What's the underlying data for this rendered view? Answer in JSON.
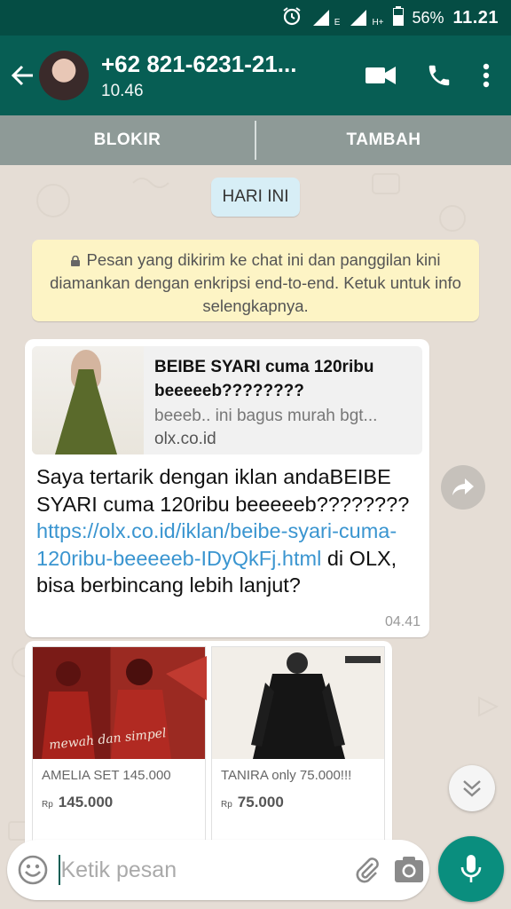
{
  "status_bar": {
    "network_left": "E",
    "network_right": "H+",
    "battery": "56%",
    "time": "11.21"
  },
  "header": {
    "contact_name": "+62 821-6231-21...",
    "last_seen": "10.46"
  },
  "actions": {
    "block_label": "BLOKIR",
    "add_label": "TAMBAH"
  },
  "chat": {
    "date_chip": "HARI INI",
    "encryption_notice": "Pesan yang dikirim ke chat ini dan panggilan kini diamankan dengan enkripsi end-to-end. Ketuk untuk info selengkapnya.",
    "message": {
      "preview_title": "BEIBE SYARI cuma 120ribu beeeeeb????????",
      "preview_desc": "beeeb.. ini bagus murah bgt...",
      "preview_domain": "olx.co.id",
      "text_before": "Saya tertarik dengan iklan andaBEIBE SYARI cuma 120ribu beeeeeb???????? ",
      "link": "https://olx.co.id/iklan/beibe-syari-cuma-120ribu-beeeeeb-IDyQkFj.html",
      "text_after": " di OLX, bisa berbincang lebih lanjut?",
      "time": "04.41"
    },
    "products": [
      {
        "name": "AMELIA SET 145.000",
        "currency": "Rp",
        "price": "145.000",
        "image_caption": "mewah dan simpel"
      },
      {
        "name": "TANIRA only 75.000!!!",
        "currency": "Rp",
        "price": "75.000"
      }
    ]
  },
  "input": {
    "placeholder": "Ketik pesan"
  },
  "colors": {
    "header": "#075e54",
    "status_bar": "#054d44",
    "accent": "#0a8e7e",
    "link": "#3a95d0",
    "chat_bg": "#e5ddd5"
  }
}
